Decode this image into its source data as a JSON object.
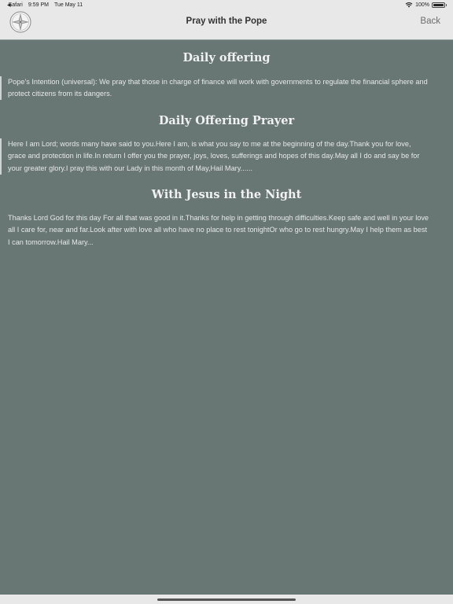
{
  "status_bar": {
    "back_app": "Safari",
    "time": "9:59 PM",
    "date": "Tue May 11",
    "battery": "100%"
  },
  "navbar": {
    "title": "Pray with the Pope",
    "back_label": "Back",
    "logo_icon": "compass-rose-logo-icon"
  },
  "sections": [
    {
      "title": "Daily offering",
      "text": "Pope's Intention (universal): We pray that those in charge of finance will work with governments to regulate the financial sphere and protect citizens from its dangers."
    },
    {
      "title": "Daily Offering Prayer",
      "text": "Here I am Lord; words many have said to you.Here I am, is what you say to me at the beginning of the day.Thank you for love, grace and protection in life.In return I offer you the prayer, joys, loves, sufferings and hopes of this day.May all I do and say be for your greater glory.I pray this with our Lady in this month of May,Hail Mary......"
    },
    {
      "title": "With Jesus in the Night",
      "text": "Thanks Lord God for this day  For all that was good in it.Thanks for help in getting through difficulties.Keep safe and well in your love all I care for, near and far.Look after with love all who have no place to rest tonightOr who go to rest hungry.May I help them as best I can tomorrow.Hail Mary..."
    }
  ],
  "colors": {
    "background": "#687674",
    "bar": "#e8e8e8",
    "text": "#e6e9e8"
  }
}
